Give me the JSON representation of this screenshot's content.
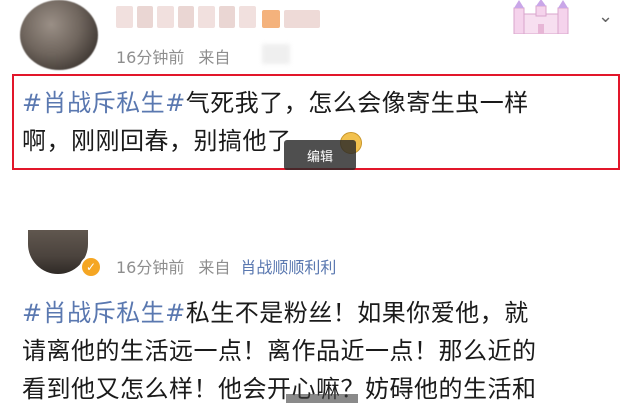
{
  "post1": {
    "time": "16分钟前",
    "source_label": "来自",
    "hashtag": "#肖战斥私生#",
    "text_line1": "气死我了，怎么会像寄生虫一样",
    "text_line2": "啊，刚刚回春，别搞他了",
    "edit_badge": "编辑"
  },
  "post2": {
    "time": "16分钟前",
    "source_label": "来自",
    "source_name": "肖战顺顺利利",
    "hashtag": "#肖战斥私生#",
    "text_line1": "私生不是粉丝！如果你爱他，就",
    "text_line2": "请离他的生活远一点！离作品近一点！那么近的",
    "text_line3": "看到他又怎么样！他会开心嘛？妨碍他的生活和"
  },
  "colors": {
    "hashtag": "#5a78b0",
    "highlight_border": "#e2162a",
    "meta": "#8e8e8e"
  },
  "icons": [
    "avatar",
    "castle-decoration",
    "chevron-down-icon",
    "vip-badge-icon",
    "emoji-icon"
  ]
}
